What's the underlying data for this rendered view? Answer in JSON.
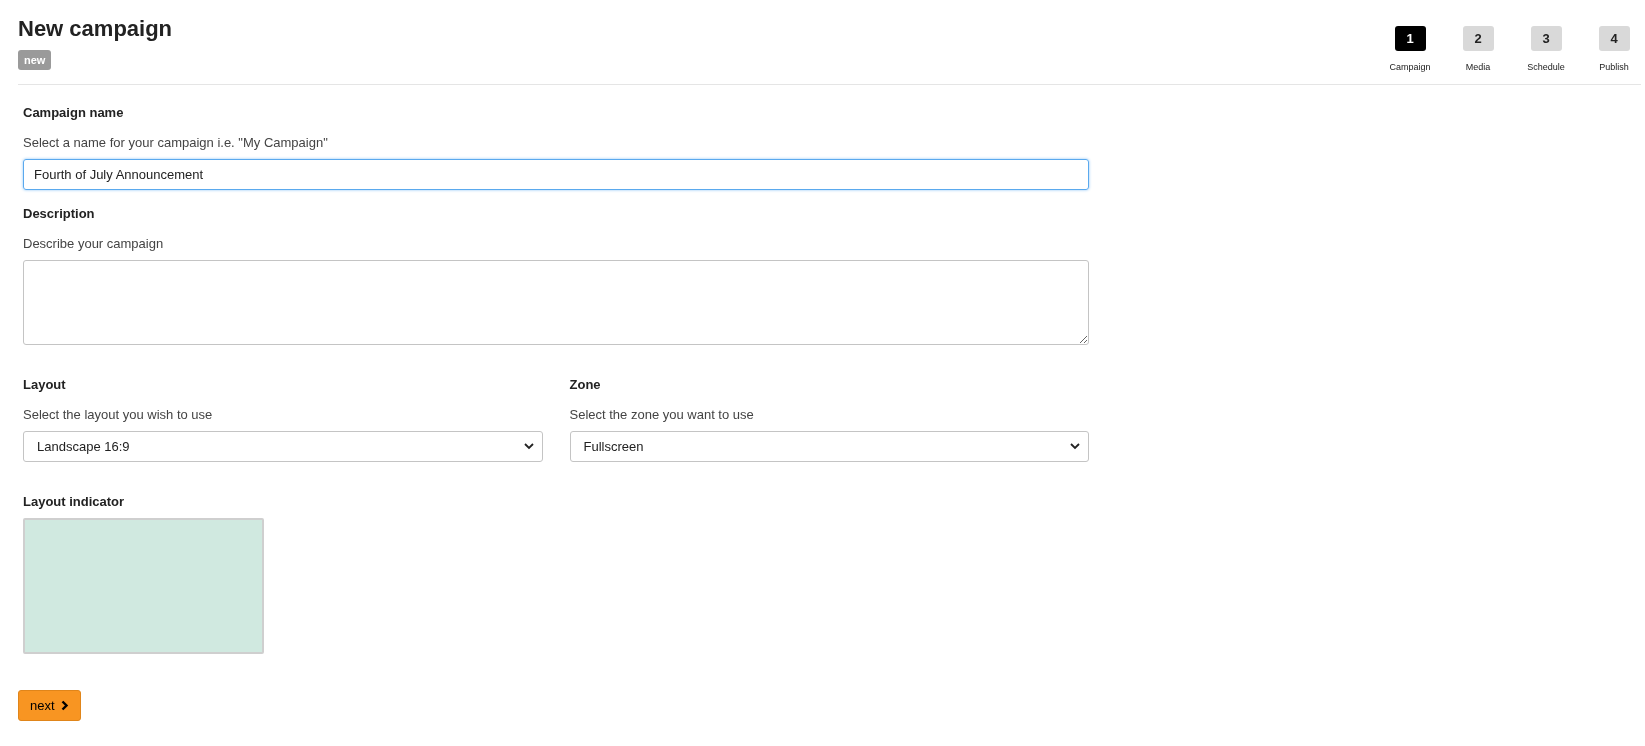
{
  "header": {
    "title": "New campaign",
    "badge": "new"
  },
  "steps": [
    {
      "number": "1",
      "label": "Campaign",
      "selected": true
    },
    {
      "number": "2",
      "label": "Media",
      "selected": false
    },
    {
      "number": "3",
      "label": "Schedule",
      "selected": false
    },
    {
      "number": "4",
      "label": "Publish",
      "selected": false
    }
  ],
  "campaign_name": {
    "label": "Campaign name",
    "hint": "Select a name for your campaign i.e. \"My Campaign\"",
    "value": "Fourth of July Announcement"
  },
  "description": {
    "label": "Description",
    "hint": "Describe your campaign"
  },
  "layout": {
    "label": "Layout",
    "hint": "Select the layout you wish to use",
    "value": "Landscape 16:9"
  },
  "zone": {
    "label": "Zone",
    "hint": "Select the zone you want to use",
    "value": "Fullscreen"
  },
  "layout_indicator": {
    "label": "Layout indicator"
  },
  "next_button": {
    "label": "next"
  }
}
